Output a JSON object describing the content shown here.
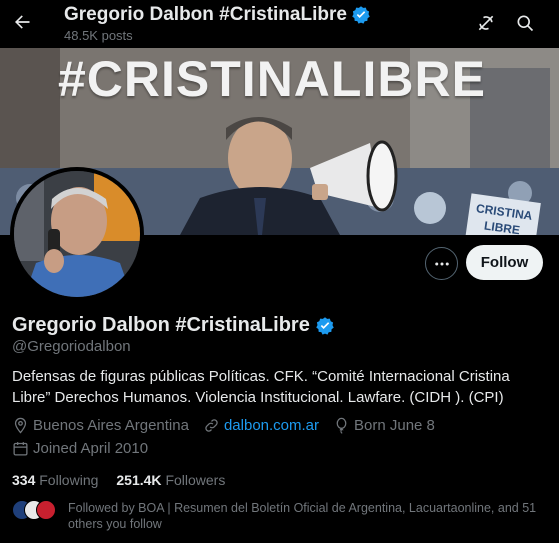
{
  "header": {
    "name": "Gregorio Dalbon #CristinaLibre",
    "posts": "48.5K posts"
  },
  "banner": {
    "text": "#CRISTINALIBRE",
    "sign_text": "CRISTINA LIBRE"
  },
  "actions": {
    "follow_label": "Follow"
  },
  "profile": {
    "display_name": "Gregorio Dalbon #CristinaLibre",
    "handle": "@Gregoriodalbon",
    "bio": "Defensas de figuras públicas Políticas. CFK. “Comité Internacional Cristina Libre” Derechos Humanos. Violencia Institucional. Lawfare. (CIDH ). (CPI)",
    "location": "Buenos Aires Argentina",
    "website": "dalbon.com.ar",
    "born": "Born June 8",
    "joined": "Joined April 2010"
  },
  "stats": {
    "following_count": "334",
    "following_label": "Following",
    "followers_count": "251.4K",
    "followers_label": "Followers"
  },
  "followed_by": {
    "text": "Followed by BOA | Resumen del Boletín Oficial de Argentina, Lacuartaonline, and 51 others you follow"
  },
  "colors": {
    "background": "#000000",
    "text": "#e7e9ea",
    "muted": "#71767b",
    "link": "#1d9bf0",
    "verified": "#1d9bf0",
    "follow_button_bg": "#eff3f4"
  },
  "icons": [
    "back-arrow-icon",
    "grok-icon",
    "search-icon",
    "verified-badge-icon",
    "more-icon",
    "location-icon",
    "link-icon",
    "balloon-icon",
    "calendar-icon"
  ]
}
